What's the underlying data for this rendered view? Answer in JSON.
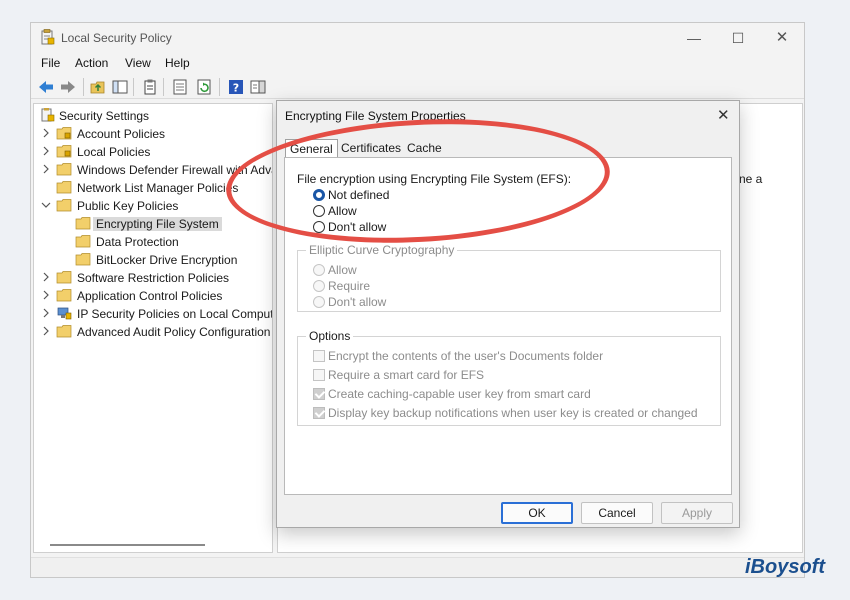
{
  "window": {
    "title": "Local Security Policy",
    "minimize": "—",
    "maximize": "☐",
    "close": "✕"
  },
  "menu": {
    "file": "File",
    "action": "Action",
    "view": "View",
    "help": "Help"
  },
  "tree": {
    "items": [
      {
        "label": "Security Settings"
      },
      {
        "label": "Account Policies"
      },
      {
        "label": "Local Policies"
      },
      {
        "label": "Windows Defender Firewall with Advanced Security"
      },
      {
        "label": "Network List Manager Policies"
      },
      {
        "label": "Public Key Policies"
      },
      {
        "label": "Encrypting File System"
      },
      {
        "label": "Data Protection"
      },
      {
        "label": "BitLocker Drive Encryption"
      },
      {
        "label": "Software Restriction Policies"
      },
      {
        "label": "Application Control Policies"
      },
      {
        "label": "IP Security Policies on Local Computer"
      },
      {
        "label": "Advanced Audit Policy Configuration"
      }
    ]
  },
  "right_pane": {
    "text": "ne a"
  },
  "dialog": {
    "title": "Encrypting File System Properties",
    "close": "✕",
    "tabs": {
      "general": "General",
      "certificates": "Certificates",
      "cache": "Cache"
    },
    "efs": {
      "heading": "File encryption using Encrypting File System (EFS):",
      "not_defined": "Not defined",
      "allow": "Allow",
      "dont_allow": "Don't allow"
    },
    "ecc": {
      "legend": "Elliptic Curve Cryptography",
      "allow": "Allow",
      "require": "Require",
      "dont_allow": "Don't allow"
    },
    "options": {
      "legend": "Options",
      "encrypt_docs": "Encrypt the contents of the user's Documents folder",
      "require_smartcard": "Require a smart card for EFS",
      "caching_key": "Create caching-capable user key from smart card",
      "backup_notify": "Display key backup notifications when user key is created or changed"
    },
    "buttons": {
      "ok": "OK",
      "cancel": "Cancel",
      "apply": "Apply"
    }
  },
  "watermark": "iBoysoft",
  "colors": {
    "accent": "#1a56a6",
    "highlight": "#e44e45",
    "ok_border": "#2a6fd6"
  }
}
